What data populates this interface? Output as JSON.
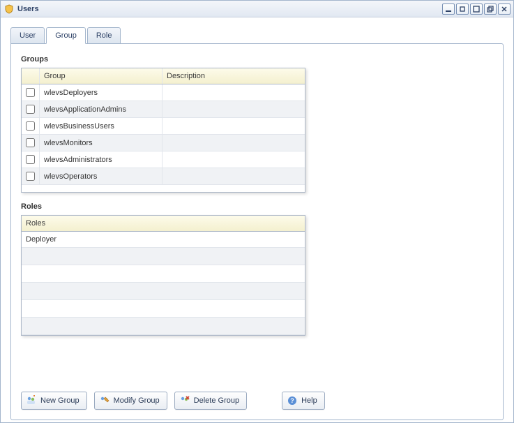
{
  "window": {
    "title": "Users"
  },
  "tabs": [
    {
      "label": "User",
      "active": false
    },
    {
      "label": "Group",
      "active": true
    },
    {
      "label": "Role",
      "active": false
    }
  ],
  "groups_section": {
    "label": "Groups",
    "columns": {
      "group": "Group",
      "description": "Description"
    },
    "rows": [
      {
        "group": "wlevsDeployers",
        "description": ""
      },
      {
        "group": "wlevsApplicationAdmins",
        "description": ""
      },
      {
        "group": "wlevsBusinessUsers",
        "description": ""
      },
      {
        "group": "wlevsMonitors",
        "description": ""
      },
      {
        "group": "wlevsAdministrators",
        "description": ""
      },
      {
        "group": "wlevsOperators",
        "description": ""
      }
    ]
  },
  "roles_section": {
    "label": "Roles",
    "column": "Roles",
    "rows": [
      {
        "role": "Deployer"
      },
      {
        "role": ""
      },
      {
        "role": ""
      },
      {
        "role": ""
      },
      {
        "role": ""
      },
      {
        "role": ""
      }
    ]
  },
  "buttons": {
    "new_group": "New Group",
    "modify_group": "Modify Group",
    "delete_group": "Delete Group",
    "help": "Help"
  }
}
